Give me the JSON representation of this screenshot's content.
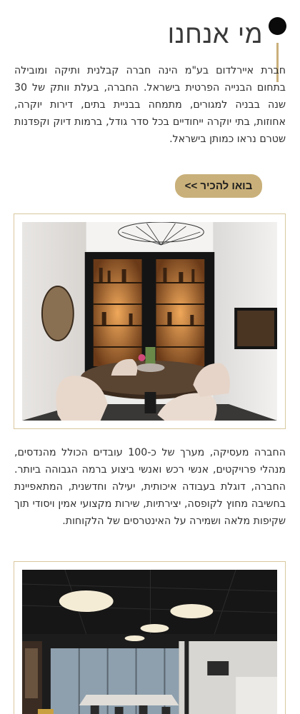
{
  "section": {
    "title": "מי אנחנו",
    "intro": "חברת איירלדום בע\"מ הינה חברה קבלנית ותיקה ומובילה בתחום הבנייה הפרטית בישראל. החברה, בעלת וותק של 30 שנה בבניה למגורים, מתמחה בבניית בתים, דירות יוקרה, אחוזות, בתי יוקרה ייחודיים בכל סדר גודל, ברמות דיוק וקפדנות שטרם נראו כמותן בישראל.",
    "cta_label": "בואו להכיר >>",
    "second_paragraph": "החברה מעסיקה, מערך של כ-100 עובדים הכולל מהנדסים, מנהלי פרויקטים, אנשי רכש ואנשי ביצוע ברמה הגבוהה ביותר. החברה, דוגלת בעבודה איכותית, יעילה וחדשנית, המתאפיינת בחשיבה מחוץ לקופסה, יצירתיות, שירות מקצועי אמין ויסודי תוך שקיפות מלאה ושמירה על האינטרסים של הלקוחות."
  },
  "colors": {
    "accent_gold": "#c9b07a",
    "dot": "#0a0a0a",
    "text": "#2f2f2f"
  }
}
